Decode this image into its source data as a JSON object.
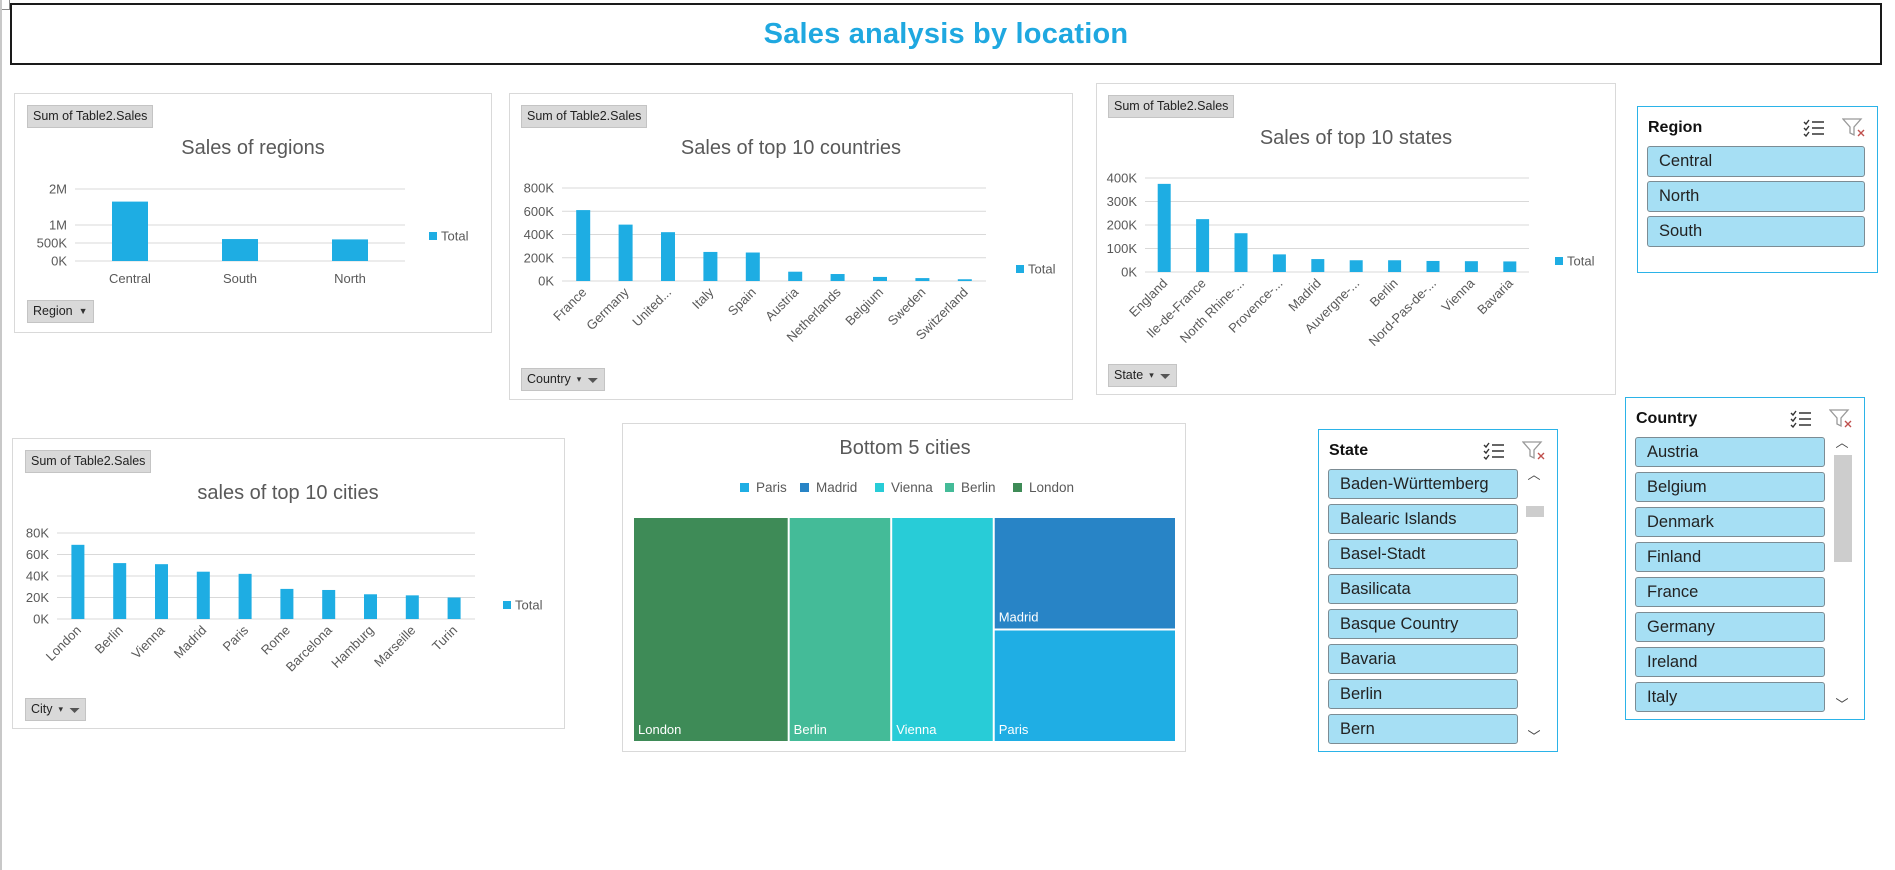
{
  "dashboard": {
    "title": "Sales analysis by location"
  },
  "colors": {
    "accent": "#1fa8e0",
    "bar": "#1eade3",
    "slicer_item": "#a6dff4",
    "slicer_border": "#2bb3e8"
  },
  "charts": {
    "regions": {
      "field_label": "Sum of Table2.Sales",
      "filter_label": "Region",
      "filter_active": false
    },
    "countries": {
      "field_label": "Sum of Table2.Sales",
      "filter_label": "Country",
      "filter_active": true
    },
    "states": {
      "field_label": "Sum of Table2.Sales",
      "filter_label": "State",
      "filter_active": true
    },
    "cities": {
      "field_label": "Sum of Table2.Sales",
      "filter_label": "City",
      "filter_active": true
    }
  },
  "chart_data": [
    {
      "id": "regions",
      "type": "bar",
      "title": "Sales of regions",
      "categories": [
        "Central",
        "South",
        "North"
      ],
      "series": [
        {
          "name": "Total",
          "values": [
            1650000,
            610000,
            600000
          ]
        }
      ],
      "ylim": [
        0,
        2000000
      ],
      "yticks": [
        "0K",
        "500K",
        "1M",
        "2M"
      ],
      "ytick_values": [
        0,
        500000,
        1000000,
        2000000
      ],
      "legend": "right",
      "grid": true
    },
    {
      "id": "countries",
      "type": "bar",
      "title": "Sales of top 10 countries",
      "categories": [
        "France",
        "Germany",
        "United...",
        "Italy",
        "Spain",
        "Austria",
        "Netherlands",
        "Belgium",
        "Sweden",
        "Switzerland"
      ],
      "series": [
        {
          "name": "Total",
          "values": [
            610000,
            485000,
            420000,
            250000,
            245000,
            80000,
            60000,
            35000,
            25000,
            15000
          ]
        }
      ],
      "ylim": [
        0,
        800000
      ],
      "yticks": [
        "0K",
        "200K",
        "400K",
        "600K",
        "800K"
      ],
      "ytick_values": [
        0,
        200000,
        400000,
        600000,
        800000
      ],
      "legend": "right",
      "grid": true
    },
    {
      "id": "states",
      "type": "bar",
      "title": "Sales of top 10 states",
      "categories": [
        "England",
        "Ile-de-France",
        "North Rhine-...",
        "Provence-...",
        "Madrid",
        "Auvergne-...",
        "Berlin",
        "Nord-Pas-de-...",
        "Vienna",
        "Bavaria"
      ],
      "series": [
        {
          "name": "Total",
          "values": [
            375000,
            225000,
            165000,
            75000,
            55000,
            50000,
            50000,
            47000,
            46000,
            45000
          ]
        }
      ],
      "ylim": [
        0,
        400000
      ],
      "yticks": [
        "0K",
        "100K",
        "200K",
        "300K",
        "400K"
      ],
      "ytick_values": [
        0,
        100000,
        200000,
        300000,
        400000
      ],
      "legend": "right",
      "grid": true
    },
    {
      "id": "cities",
      "type": "bar",
      "title": "sales of top 10 cities",
      "categories": [
        "London",
        "Berlin",
        "Vienna",
        "Madrid",
        "Paris",
        "Rome",
        "Barcelona",
        "Hamburg",
        "Marseille",
        "Turin"
      ],
      "series": [
        {
          "name": "Total",
          "values": [
            69000,
            52000,
            51000,
            44000,
            42000,
            28000,
            27000,
            23000,
            22000,
            20000
          ]
        }
      ],
      "ylim": [
        0,
        80000
      ],
      "yticks": [
        "0K",
        "20K",
        "40K",
        "60K",
        "80K"
      ],
      "ytick_values": [
        0,
        20000,
        40000,
        60000,
        80000
      ],
      "legend": "right",
      "grid": true
    },
    {
      "id": "bottom-cities",
      "type": "treemap",
      "title": "Bottom 5 cities",
      "legend_order": [
        "Paris",
        "Madrid",
        "Vienna",
        "Berlin",
        "London"
      ],
      "items": [
        {
          "name": "London",
          "value": 41000,
          "color": "#3e8b57"
        },
        {
          "name": "Berlin",
          "value": 27000,
          "color": "#44bb98"
        },
        {
          "name": "Vienna",
          "value": 27000,
          "color": "#28ccd7"
        },
        {
          "name": "Madrid",
          "value": 24000,
          "color": "#2884c6"
        },
        {
          "name": "Paris",
          "value": 24000,
          "color": "#1faee4"
        }
      ],
      "legend": "top"
    }
  ],
  "slicers": {
    "region": {
      "title": "Region",
      "items": [
        "Central",
        "North",
        "South"
      ]
    },
    "state": {
      "title": "State",
      "items": [
        "Baden-Württemberg",
        "Balearic Islands",
        "Basel-Stadt",
        "Basilicata",
        "Basque Country",
        "Bavaria",
        "Berlin",
        "Bern"
      ]
    },
    "country": {
      "title": "Country",
      "items": [
        "Austria",
        "Belgium",
        "Denmark",
        "Finland",
        "France",
        "Germany",
        "Ireland",
        "Italy"
      ]
    }
  }
}
